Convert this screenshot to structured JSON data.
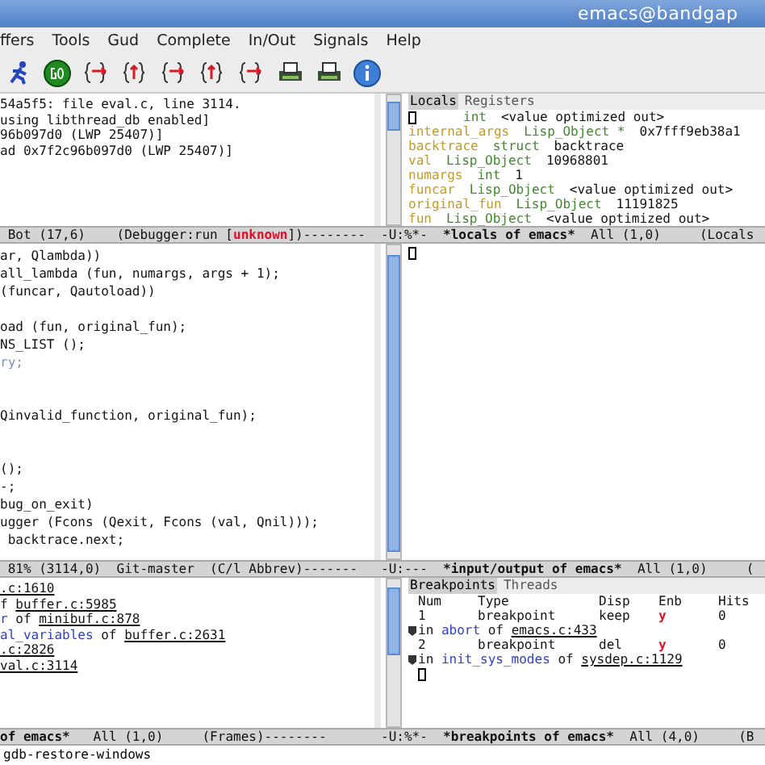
{
  "window": {
    "title": "emacs@bandgap"
  },
  "menu": [
    "ffers",
    "Tools",
    "Gud",
    "Complete",
    "In/Out",
    "Signals",
    "Help"
  ],
  "gud": {
    "lines": [
      "54a5f5: file eval.c, line 3114.",
      "using libthread_db enabled]",
      "96b097d0 (LWP 25407)]",
      "ad 0x7f2c96b097d0 (LWP 25407)]"
    ],
    "modeline": [
      {
        "text": " Bot (17,6)    ",
        "kind": "plain"
      },
      {
        "text": "(Debugger:run [",
        "kind": "plain"
      },
      {
        "text": "unknown",
        "kind": "alert"
      },
      {
        "text": "])--------",
        "kind": "plain"
      }
    ]
  },
  "source": {
    "lines": [
      {
        "text": "ar, Qlambda))",
        "kind": "code"
      },
      {
        "text": "all_lambda (fun, numargs, args + 1);",
        "kind": "code"
      },
      {
        "text": "(funcar, Qautoload))",
        "kind": "code"
      },
      {
        "kind": "blank"
      },
      {
        "text": "oad (fun, original_fun);",
        "kind": "code"
      },
      {
        "text": "NS_LIST ();",
        "kind": "code"
      },
      {
        "text": "ry;",
        "kind": "keyword"
      },
      {
        "kind": "blank"
      },
      {
        "kind": "blank"
      },
      {
        "text": "Qinvalid_function, original_fun);",
        "kind": "code"
      },
      {
        "kind": "blank"
      },
      {
        "kind": "blank"
      },
      {
        "text": "();",
        "kind": "code"
      },
      {
        "text": "-;",
        "kind": "code"
      },
      {
        "text": "bug_on_exit)",
        "kind": "code"
      },
      {
        "text": "ugger (Fcons (Qexit, Fcons (val, Qnil)));",
        "kind": "code"
      },
      {
        "text": " backtrace.next;",
        "kind": "code"
      }
    ],
    "modeline": [
      {
        "text": " 81% (3114,0)  Git-master  (C/l Abbrev)",
        "kind": "plain"
      },
      {
        "text": "-------",
        "kind": "plain"
      }
    ]
  },
  "frames": {
    "lines": [
      [
        {
          "text": ".c:1610",
          "kind": "file"
        }
      ],
      [
        {
          "text": "f ",
          "kind": "plain"
        },
        {
          "text": "buffer.c:5985",
          "kind": "file"
        }
      ],
      [
        {
          "text": "r",
          "kind": "func"
        },
        {
          "text": " of ",
          "kind": "plain"
        },
        {
          "text": "minibuf.c:878",
          "kind": "file"
        }
      ],
      [
        {
          "text": "al_variables",
          "kind": "func"
        },
        {
          "text": " of ",
          "kind": "plain"
        },
        {
          "text": "buffer.c:2631",
          "kind": "file"
        }
      ],
      [
        {
          "text": ".c:2826",
          "kind": "file"
        }
      ],
      [
        {
          "text": "val.c:3114",
          "kind": "file"
        }
      ]
    ],
    "modeline": [
      {
        "text": "of emacs*",
        "kind": "bold"
      },
      {
        "text": "   All (1,0)     (Frames)--------",
        "kind": "plain"
      }
    ]
  },
  "locals": {
    "tabs": [
      {
        "label": "Locals",
        "selected": true
      },
      {
        "label": "Registers",
        "selected": false
      }
    ],
    "rows": [
      {
        "type": "int",
        "value": "<value optimized out>"
      },
      {
        "name": "internal_args",
        "type": "Lisp_Object *",
        "value": "0x7fff9eb38a1"
      },
      {
        "name": "backtrace",
        "type": "struct",
        "value": "backtrace"
      },
      {
        "name": "val",
        "type": "Lisp_Object",
        "value": "10968801"
      },
      {
        "name": "numargs",
        "type": "int",
        "value": "1"
      },
      {
        "name": "funcar",
        "type": "Lisp_Object",
        "value": "<value optimized out>"
      },
      {
        "name": "original_fun",
        "type": "Lisp_Object",
        "value": "11191825"
      },
      {
        "name": "fun",
        "type": "Lisp_Object",
        "value": "<value optimized out>"
      }
    ],
    "modeline": [
      {
        "text": "-U:%*-  ",
        "kind": "plain"
      },
      {
        "text": "*locals of emacs*",
        "kind": "bold"
      },
      {
        "text": "  All (1,0)     (Locals",
        "kind": "plain"
      }
    ]
  },
  "io": {
    "modeline": [
      {
        "text": "-U:---  ",
        "kind": "plain"
      },
      {
        "text": "*input/output of emacs*",
        "kind": "bold"
      },
      {
        "text": "  All (1,0)     (",
        "kind": "plain"
      }
    ]
  },
  "breakpoints": {
    "tabs": [
      {
        "label": "Breakpoints",
        "selected": true
      },
      {
        "label": "Threads",
        "selected": false
      }
    ],
    "columns": [
      "Num",
      "Type",
      "Disp",
      "Enb",
      "Hits"
    ],
    "rows": [
      {
        "cells": [
          "1",
          "breakpoint",
          "keep",
          "y",
          "0"
        ],
        "location": [
          {
            "text": "in ",
            "kind": "plain"
          },
          {
            "text": "abort",
            "kind": "func"
          },
          {
            "text": " of ",
            "kind": "plain"
          },
          {
            "text": "emacs.c:433",
            "kind": "file"
          }
        ]
      },
      {
        "cells": [
          "2",
          "breakpoint",
          "del",
          "y",
          "0"
        ],
        "location": [
          {
            "text": "in ",
            "kind": "plain"
          },
          {
            "text": "init_sys_modes",
            "kind": "func"
          },
          {
            "text": " of ",
            "kind": "plain"
          },
          {
            "text": "sysdep.c:1129",
            "kind": "file"
          }
        ]
      }
    ],
    "modeline": [
      {
        "text": "-U:%*-  ",
        "kind": "plain"
      },
      {
        "text": "*breakpoints of emacs*",
        "kind": "bold"
      },
      {
        "text": "  All (4,0)     (B",
        "kind": "plain"
      }
    ]
  },
  "minibuffer": {
    "text": "gdb-restore-windows"
  }
}
